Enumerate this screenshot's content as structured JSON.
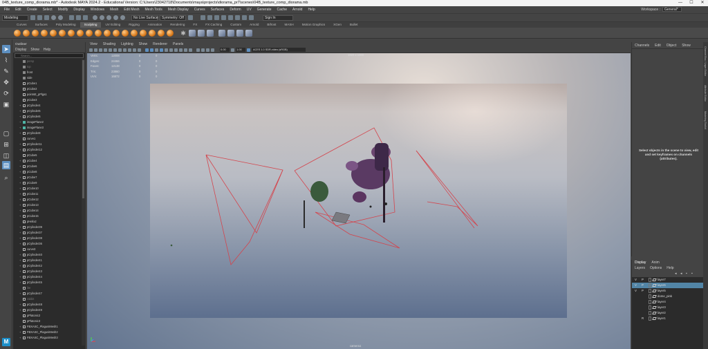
{
  "window": {
    "title": "04B_texture_comp_diorama.mb* - Autodesk MAYA 2024.2 - Educational Version: C:\\Users\\23042718\\Documents\\maya\\projects\\diorama_pr7\\scenes\\04B_texture_comp_diorama.mb",
    "controls": [
      "—",
      "☐",
      "✕"
    ]
  },
  "menubar": {
    "items": [
      "File",
      "Edit",
      "Create",
      "Select",
      "Modify",
      "Display",
      "Windows",
      "Mesh",
      "Edit Mesh",
      "Mesh Tools",
      "Mesh Display",
      "Curves",
      "Surfaces",
      "Deform",
      "UV",
      "Generate",
      "Cache",
      "Arnold",
      "Help"
    ],
    "workspace_label": "Workspace :",
    "workspace_value": "General*"
  },
  "statusline": {
    "mode": "Modeling",
    "live_surface": "No Live Surface",
    "symmetry": "Symmetry: Off",
    "sign_in": "Sign In"
  },
  "shelf": {
    "tabs": [
      "Curves",
      "Surfaces",
      "Poly Modeling",
      "Sculpting",
      "UV Editing",
      "Rigging",
      "Animation",
      "Rendering",
      "FX",
      "FX Caching",
      "Custom",
      "Arnold",
      "Bifrost",
      "MASH",
      "Motion Graphics",
      "XGen",
      "Bullet"
    ],
    "active_tab": "Sculpting"
  },
  "outliner": {
    "title": "Outliner",
    "menu": [
      "Display",
      "Show",
      "Help"
    ],
    "search_placeholder": "Search...",
    "items": [
      {
        "name": "persp",
        "icon": "cam",
        "dim": true
      },
      {
        "name": "top",
        "icon": "cam",
        "dim": true
      },
      {
        "name": "front",
        "icon": "cam",
        "dim": false
      },
      {
        "name": "side",
        "icon": "cam",
        "dim": false
      },
      {
        "name": "pCube1",
        "icon": "mesh",
        "dim": false
      },
      {
        "name": "pCube2",
        "icon": "mesh",
        "dim": false
      },
      {
        "name": "pointsE_pPlga1",
        "icon": "mesh",
        "dim": false
      },
      {
        "name": "pCube3",
        "icon": "mesh",
        "dim": false
      },
      {
        "name": "pCylinder4",
        "icon": "grp",
        "dim": false,
        "expand": true
      },
      {
        "name": "pCylinder5",
        "icon": "grp",
        "dim": false,
        "expand": true
      },
      {
        "name": "pCylinder6",
        "icon": "grp",
        "dim": false,
        "expand": true
      },
      {
        "name": "imagePlane2",
        "icon": "img",
        "dim": false,
        "expand": true
      },
      {
        "name": "imagePlane3",
        "icon": "img",
        "dim": false,
        "expand": true
      },
      {
        "name": "pCylinder8",
        "icon": "grp",
        "dim": false,
        "expand": true
      },
      {
        "name": "curve1",
        "icon": "mesh",
        "dim": false
      },
      {
        "name": "pCylinder11",
        "icon": "grp",
        "dim": false,
        "expand": true
      },
      {
        "name": "pCylinder12",
        "icon": "grp",
        "dim": false,
        "expand": true
      },
      {
        "name": "pCube5",
        "icon": "mesh",
        "dim": false
      },
      {
        "name": "pCube4",
        "icon": "grp",
        "dim": false,
        "expand": true
      },
      {
        "name": "pCube6",
        "icon": "grp",
        "dim": false,
        "expand": true
      },
      {
        "name": "pCube8",
        "icon": "grp",
        "dim": false,
        "expand": true
      },
      {
        "name": "pCube7",
        "icon": "grp",
        "dim": false,
        "expand": true
      },
      {
        "name": "pCube9",
        "icon": "grp",
        "dim": false,
        "expand": true
      },
      {
        "name": "pCube10",
        "icon": "grp",
        "dim": false,
        "expand": true
      },
      {
        "name": "pCube11",
        "icon": "grp",
        "dim": false,
        "expand": true
      },
      {
        "name": "pCube12",
        "icon": "grp",
        "dim": false,
        "expand": true
      },
      {
        "name": "pCube13",
        "icon": "grp",
        "dim": false,
        "expand": true
      },
      {
        "name": "pCube14",
        "icon": "grp",
        "dim": false,
        "expand": true
      },
      {
        "name": "pCube15",
        "icon": "grp",
        "dim": false,
        "expand": true
      },
      {
        "name": "pHelix2",
        "icon": "mesh",
        "dim": false
      },
      {
        "name": "pCylinder39",
        "icon": "grp",
        "dim": false,
        "expand": true
      },
      {
        "name": "pCylinder37",
        "icon": "grp",
        "dim": false,
        "expand": true
      },
      {
        "name": "pCylinder38",
        "icon": "grp",
        "dim": false,
        "expand": true
      },
      {
        "name": "pCylinder36",
        "icon": "grp",
        "dim": false,
        "expand": true
      },
      {
        "name": "curve3",
        "icon": "mesh",
        "dim": false
      },
      {
        "name": "pCylinder40",
        "icon": "grp",
        "dim": false,
        "expand": true
      },
      {
        "name": "pCylinder41",
        "icon": "grp",
        "dim": false,
        "expand": true
      },
      {
        "name": "pCylinder42",
        "icon": "grp",
        "dim": false,
        "expand": true
      },
      {
        "name": "pCylinder43",
        "icon": "grp",
        "dim": false,
        "expand": true
      },
      {
        "name": "pCylinder44",
        "icon": "grp",
        "dim": false,
        "expand": true
      },
      {
        "name": "pCylinder45",
        "icon": "grp",
        "dim": false,
        "expand": true
      },
      {
        "name": "lite",
        "icon": "mesh",
        "dim": true
      },
      {
        "name": "pCylinder47",
        "icon": "grp",
        "dim": false,
        "expand": true
      },
      {
        "name": "rabbit",
        "icon": "mesh",
        "dim": true
      },
      {
        "name": "pCylinder48",
        "icon": "grp",
        "dim": false,
        "expand": true
      },
      {
        "name": "pCylinder49",
        "icon": "grp",
        "dim": false,
        "expand": true
      },
      {
        "name": "pPlatonic2",
        "icon": "mesh",
        "dim": false
      },
      {
        "name": "pPlatonic3",
        "icon": "mesh",
        "dim": false
      },
      {
        "name": "FBXASC_PlaguniMesh1",
        "icon": "grp",
        "dim": false,
        "expand": true
      },
      {
        "name": "FBXASC_PlaguniMesh2",
        "icon": "grp",
        "dim": false,
        "expand": true
      },
      {
        "name": "FBXASC_PlaguniMesh3",
        "icon": "grp",
        "dim": false,
        "expand": true
      }
    ]
  },
  "viewport": {
    "menu": [
      "View",
      "Shading",
      "Lighting",
      "Show",
      "Renderer",
      "Panels"
    ],
    "exposure": "0.00",
    "gamma": "1.00",
    "colorspace": "ACES 1.0 SDR-video (sRGB)",
    "resolution_gate": "1920 x 1080",
    "camera_label": "camera1",
    "hud": [
      {
        "label": "Verts:",
        "a": "12008",
        "b": "0",
        "c": "0"
      },
      {
        "label": "Edges:",
        "a": "24466",
        "b": "0",
        "c": "0"
      },
      {
        "label": "Faces:",
        "a": "12138",
        "b": "0",
        "c": "0"
      },
      {
        "label": "Tris:",
        "a": "23860",
        "b": "0",
        "c": "0"
      },
      {
        "label": "UVs:",
        "a": "16872",
        "b": "0",
        "c": "0"
      }
    ]
  },
  "channelbox": {
    "menu": [
      "Channels",
      "Edit",
      "Object",
      "Show"
    ],
    "empty_message": "Select objects in the scene to view, edit and set keyframes on channels (attributes)."
  },
  "side_tabs": [
    "Channel Box / Layer Editor",
    "Attribute Editor",
    "Modeling Toolkit"
  ],
  "layer_editor": {
    "tabs": [
      "Display",
      "Anim"
    ],
    "menu": [
      "Layers",
      "Options",
      "Help"
    ],
    "layers": [
      {
        "v": "V",
        "p": "P",
        "name": "layer7",
        "selected": false
      },
      {
        "v": "V",
        "p": "P",
        "name": "layer6",
        "selected": true
      },
      {
        "v": "V",
        "p": "P",
        "name": "layer5",
        "selected": false
      },
      {
        "v": "",
        "p": "",
        "name": "dome_pink",
        "selected": false
      },
      {
        "v": "",
        "p": "",
        "name": "layer4",
        "selected": false
      },
      {
        "v": "",
        "p": "",
        "name": "layer3",
        "selected": false
      },
      {
        "v": "",
        "p": "",
        "name": "layer2",
        "selected": false
      },
      {
        "v": "",
        "p": "R",
        "name": "layer1",
        "selected": false
      }
    ]
  },
  "colors": {
    "accent": "#5d8fc0",
    "selected_layer": "#5285a6",
    "wire_red": "#d4444c"
  }
}
